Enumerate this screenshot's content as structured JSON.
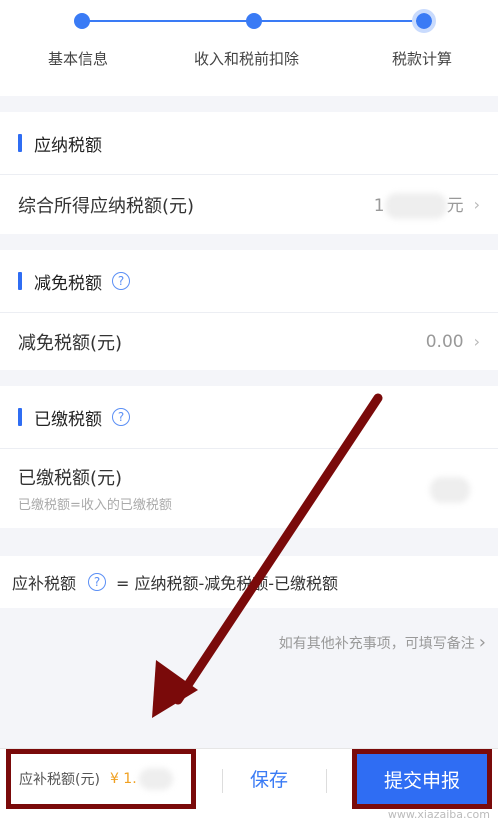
{
  "stepper": {
    "steps": [
      {
        "label": "基本信息"
      },
      {
        "label": "收入和税前扣除"
      },
      {
        "label": "税款计算"
      }
    ]
  },
  "tax_due": {
    "section_title": "应纳税额",
    "row_label": "综合所得应纳税额(元)",
    "row_value_visible": "1",
    "row_value_suffix": "元"
  },
  "tax_reduction": {
    "section_title": "减免税额",
    "row_label": "减免税额(元)",
    "row_value": "0.00"
  },
  "tax_paid": {
    "section_title": "已缴税额",
    "row_label": "已缴税额(元)",
    "row_sublabel": "已缴税额=收入的已缴税额"
  },
  "formula": {
    "label": "应补税额",
    "expression": "= 应纳税额-减免税额-已缴税额"
  },
  "remark": {
    "text": "如有其他补充事项，可填写备注"
  },
  "bottom_bar": {
    "amount_label": "应补税额(元)",
    "amount_prefix": "¥ 1.",
    "save_label": "保存",
    "submit_label": "提交申报"
  },
  "watermark": "www.xiazaiba.com",
  "colors": {
    "accent": "#3a7bf5",
    "highlight_box": "#7a0a0a",
    "arrow": "#7a0a0a",
    "amount": "#f0a020"
  },
  "icons": {
    "help": "question-circle-icon",
    "chevron": "chevron-right-icon"
  }
}
